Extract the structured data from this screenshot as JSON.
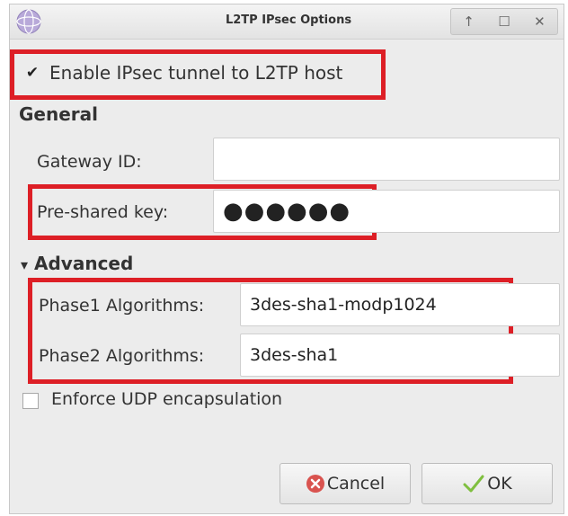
{
  "window": {
    "title": "L2TP IPsec Options",
    "controls": [
      "↑",
      "☐",
      "✕"
    ]
  },
  "ipsec": {
    "enable_label": "Enable IPsec tunnel to L2TP host",
    "enabled": true
  },
  "general": {
    "heading": "General",
    "gateway_label": "Gateway ID:",
    "gateway_value": "",
    "psk_label": "Pre-shared key:",
    "psk_masked": "●●●●●●"
  },
  "advanced": {
    "heading": "Advanced",
    "expander": "▾",
    "phase1_label": "Phase1 Algorithms:",
    "phase1_value": "3des-sha1-modp1024",
    "phase2_label": "Phase2 Algorithms:",
    "phase2_value": "3des-sha1"
  },
  "udp": {
    "label": "Enforce UDP encapsulation",
    "checked": false
  },
  "buttons": {
    "cancel": "Cancel",
    "ok": "OK"
  },
  "colors": {
    "highlight": "#dd1f26",
    "cancel_icon": "#d9534f",
    "ok_icon": "#7fbf3f"
  }
}
